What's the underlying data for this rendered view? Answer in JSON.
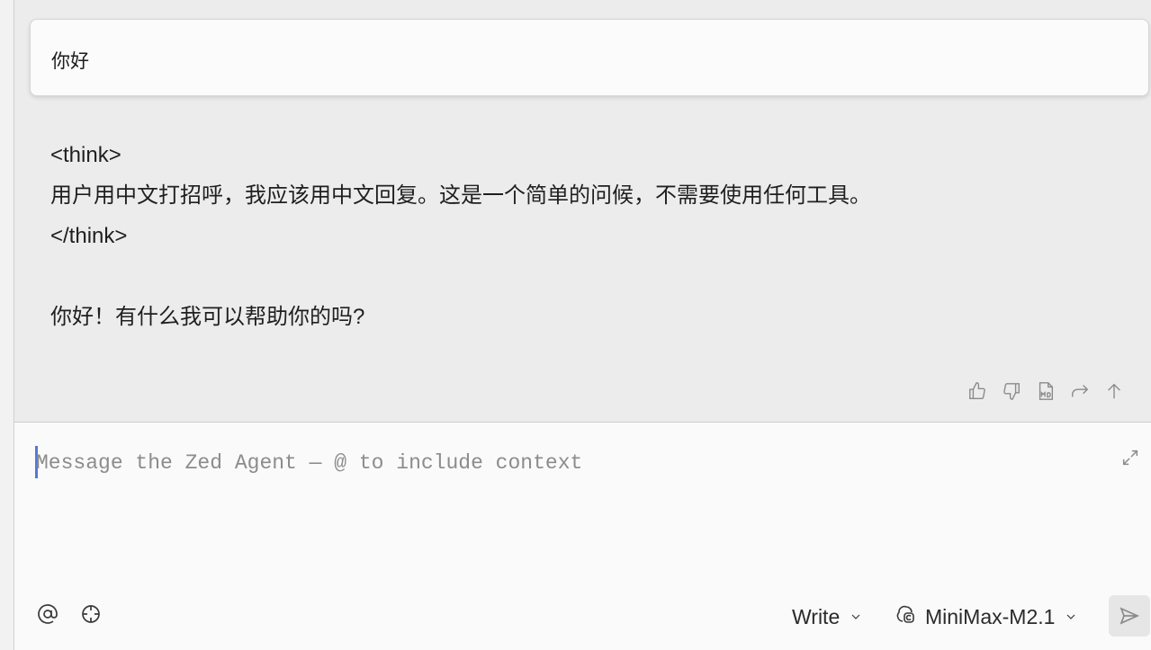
{
  "thread": {
    "user_message": "你好",
    "assistant_lines": [
      "<think>",
      "用户用中文打招呼，我应该用中文回复。这是一个简单的问候，不需要使用任何工具。",
      "</think>",
      "",
      "你好！有什么我可以帮助你的吗?"
    ],
    "actions": [
      "thumbs-up-icon",
      "thumbs-down-icon",
      "markdown-copy-icon",
      "share-icon",
      "scroll-top-icon"
    ]
  },
  "composer": {
    "placeholder": "Message the Zed Agent — @ to include context",
    "mode_label": "Write",
    "model_label": "MiniMax-M2.1"
  }
}
